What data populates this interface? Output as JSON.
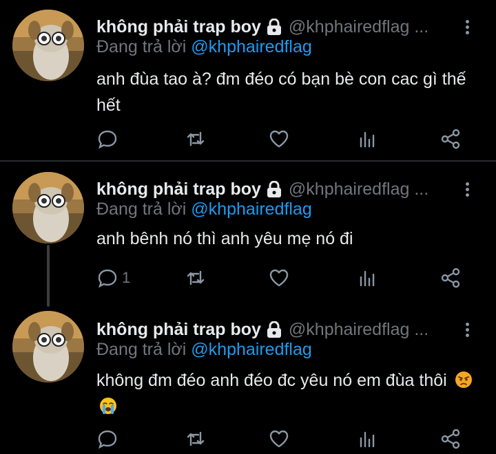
{
  "tweets": [
    {
      "author_name": "không phải trap boy",
      "handle": "@khphairedflag ...",
      "replying_prefix": "Đang trả lời",
      "replying_to": "@khphairedflag",
      "text": "anh đùa tao à? đm đéo có bạn bè con cac gì thế hết",
      "reply_count": ""
    },
    {
      "author_name": "không phải trap boy",
      "handle": "@khphairedflag ...",
      "replying_prefix": "Đang trả lời",
      "replying_to": "@khphairedflag",
      "text": "anh bênh nó thì anh yêu mẹ nó đi",
      "reply_count": "1"
    },
    {
      "author_name": "không phải trap boy",
      "handle": "@khphairedflag ...",
      "replying_prefix": "Đang trả lời",
      "replying_to": "@khphairedflag",
      "text": "không đm đéo anh đéo đc yêu nó em đùa thôi",
      "emojis": [
        "angry-face",
        "loudly-crying-face"
      ],
      "reply_count": ""
    }
  ],
  "colors": {
    "background": "#000000",
    "text": "#e7e9ea",
    "secondary": "#71767b",
    "mention": "#1d9bf0",
    "divider": "#2a2d30"
  },
  "icons": [
    "lock-icon",
    "more-icon",
    "reply-icon",
    "retweet-icon",
    "like-icon",
    "stats-icon",
    "share-icon"
  ]
}
